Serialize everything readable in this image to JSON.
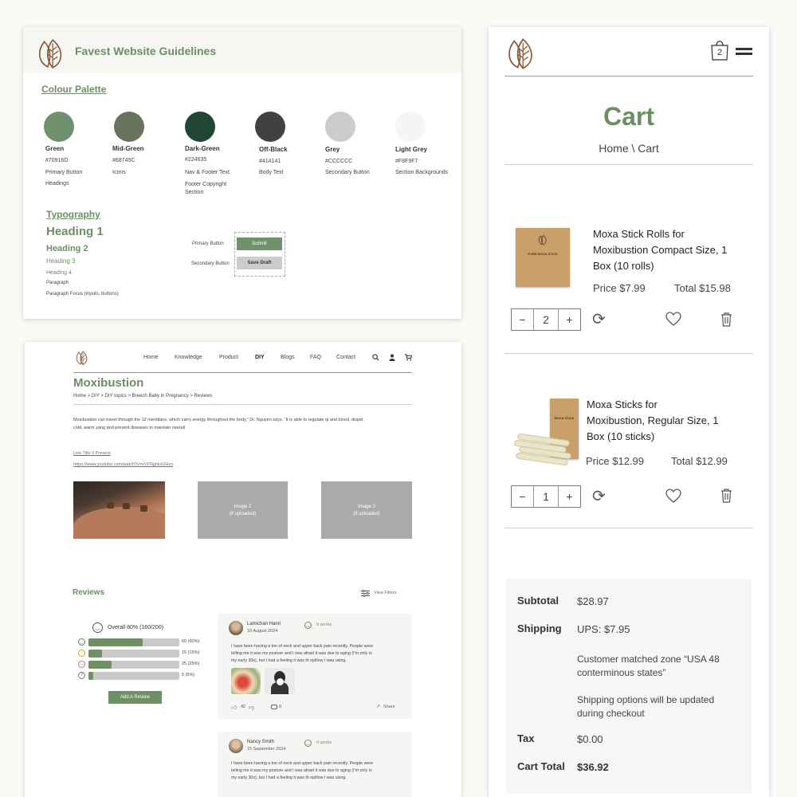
{
  "guidelines": {
    "title": "Favest Website Guidelines",
    "palette_heading": "Colour Palette",
    "colors": [
      {
        "name": "Green",
        "hex": "#70916D",
        "uses": [
          "Primary Button",
          "Headings"
        ]
      },
      {
        "name": "Mid-Green",
        "hex": "#68745C",
        "uses": [
          "Icons"
        ]
      },
      {
        "name": "Dark-Green",
        "hex": "#224635",
        "uses": [
          "Nav & Footer Text",
          "Footer Copyright",
          "Section"
        ]
      },
      {
        "name": "Off-Black",
        "hex": "#414141",
        "uses": [
          "Body Text"
        ]
      },
      {
        "name": "Grey",
        "hex": "#CCCCCC",
        "uses": [
          "Secondary Button"
        ]
      },
      {
        "name": "Light Grey",
        "hex": "#F8F9F7",
        "uses": [
          "Section Backgrounds"
        ]
      }
    ],
    "typography_heading": "Typography",
    "h1": "Heading 1",
    "h2": "Heading 2",
    "h3": "Heading 3",
    "h4": "Heading 4",
    "paragraph": "Paragraph",
    "paragraph_focus": "Paragraph Focus (inputs, buttons)",
    "primary_button_label": "Primary Button",
    "secondary_button_label": "Secondary Button",
    "submit": "Submit",
    "save_draft": "Save Draft"
  },
  "product_page": {
    "nav": [
      "Home",
      "Knowledge",
      "Product",
      "DIY",
      "Blogs",
      "FAQ",
      "Contact"
    ],
    "active_nav": "DIY",
    "title": "Moxibustion",
    "breadcrumb": "Home > DIY > DIY topics > Breech Baby in Pregnancy > Reviews",
    "body_line1": "Moxibustion can travel through the 12 meridians, which carry energy throughout the body,” Dr. Nguyen says. “It is able to regulate qi and blood, dispel",
    "body_line2": "cold, warm yang and prevent diseases to maintain overall",
    "link_title": "Link Title if Present",
    "link_url": "https://www.youtube.com/watch?v=xVFNghkxUHzo",
    "image2": "Image 2",
    "image3": "Image 3",
    "if_uploaded": "(if uploaded)",
    "reviews_heading": "Reviews",
    "view_filters": "View Filters",
    "overall": "Overall 80% (160/200)",
    "rating_rows": [
      {
        "label": "60 (60%)",
        "fraction": 0.6
      },
      {
        "label": "15 (15%)",
        "fraction": 0.15
      },
      {
        "label": "25 (25%)",
        "fraction": 0.25
      },
      {
        "label": "5 (5%)",
        "fraction": 0.05
      }
    ],
    "add_review": "Add  A Review",
    "reviews": [
      {
        "name": "Lamichan Hanri",
        "date": "10 August 2024",
        "verdict": "It works",
        "lines": [
          "I have been having a ton of neck and upper back pain recently. People were",
          "telling me it was my posture and I was afraid it was due to aging (I'm only in",
          "my early 30s), but I had a feeling it was th epillow I was using."
        ],
        "likes": "42",
        "comments": "0",
        "share": "Share"
      },
      {
        "name": "Nancy Smith",
        "date": "15 September 2024",
        "verdict": "It works",
        "lines": [
          "I have been having a ton of neck and upper back pain recently. People were",
          "telling me it was my posture and I was afraid it was due to aging (I'm only in",
          "my early 30s), but I had a feeling it was th epillow I was using."
        ]
      }
    ]
  },
  "cart": {
    "bag_count": "2",
    "title": "Cart",
    "breadcrumb": "Home \\ Cart",
    "items": [
      {
        "name_lines": [
          "Moxa Stick Rolls for",
          "Moxibustion Compact Size, 1",
          "Box (10 rolls)"
        ],
        "price": "Price $7.99",
        "total": "Total $15.98",
        "qty": "2",
        "box_title": "PURE MOXA STICK"
      },
      {
        "name_lines": [
          "Moxa Sticks for",
          "Moxibustion, Regular Size, 1",
          "Box (10 sticks)"
        ],
        "price": "Price $12.99",
        "total": "Total $12.99",
        "qty": "1",
        "box_title": "MOXA STICK"
      }
    ],
    "summary": {
      "subtotal_label": "Subtotal",
      "subtotal": "$28.97",
      "shipping_label": "Shipping",
      "shipping": "UPS: $7.95",
      "zone_line1": "Customer matched zone “USA 48",
      "zone_line2": "conterminous states”",
      "note_line1": "Shipping options will be updated",
      "note_line2": "during checkout",
      "tax_label": "Tax",
      "tax": "$0.00",
      "total_label": "Cart Total",
      "total": "$36.92"
    }
  }
}
